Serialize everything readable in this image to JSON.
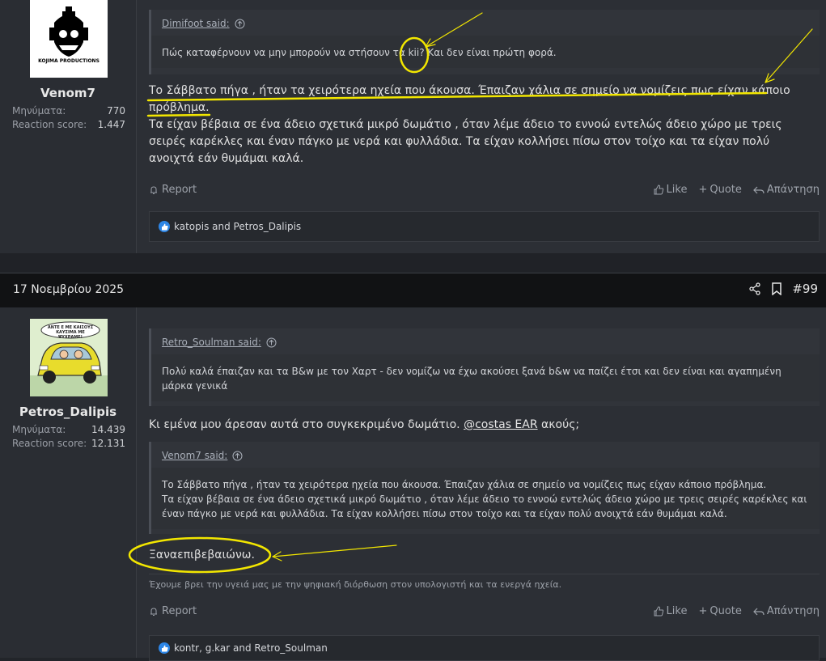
{
  "post1": {
    "username": "Venom7",
    "avatar_label": "KOJIMA PRODUCTIONS",
    "stats": [
      {
        "label": "Μηνύματα:",
        "value": "770"
      },
      {
        "label": "Reaction score:",
        "value": "1.447"
      }
    ],
    "quote": {
      "author": "Dimifoot said:",
      "body": "Πώς καταφέρνουν να μην μπορούν να στήσουν τα kii? Και δεν είναι πρώτη φορά."
    },
    "text_line1": "Το Σάββατο πήγα , ήταν τα χειρότερα ηχεία που άκουσα. Έπαιζαν χάλια σε σημείο να νομίζεις πως είχαν κάποιο",
    "text_line2": "πρόβλημα.",
    "text_para2": "Τα είχαν βέβαια σε ένα άδειο σχετικά μικρό δωμάτιο , όταν λέμε άδειο το εννοώ εντελώς άδειο χώρο με τρεις σειρές καρέκλες και έναν πάγκο με νερά και φυλλάδια. Τα είχαν κολλήσει πίσω στον τοίχο και τα είχαν πολύ ανοιχτά εάν θυμάμαι καλά.",
    "actions": {
      "report": "Report",
      "like": "Like",
      "quote": "Quote",
      "reply": "Απάντηση"
    },
    "reactions": "katopis and Petros_Dalipis"
  },
  "post2": {
    "date": "17 Νοεμβρίου 2025",
    "number": "#99",
    "username": "Petros_Dalipis",
    "avatar_caption": "ΑΝΤΕ Ε ΜΕ ΚΑΙΣΟΥΣ ΚΑΥΣΙΜΑ ΜΕ ΨΥΧΡΑΜΕ!",
    "stats": [
      {
        "label": "Μηνύματα:",
        "value": "14.439"
      },
      {
        "label": "Reaction score:",
        "value": "12.131"
      }
    ],
    "quote1": {
      "author": "Retro_Soulman said:",
      "body": "Πολύ καλά έπαιζαν και τα B&w με τον Χαρτ - δεν νομίζω να έχω ακούσει ξανά b&w να παίζει έτσι και δεν είναι και αγαπημένη μάρκα γενικά"
    },
    "text1_before": "Κι εμένα μου άρεσαν αυτά στο συγκεκριμένο δωμάτιο. ",
    "mention": "@costas EAR",
    "text1_after": " ακούς;",
    "quote2": {
      "author": "Venom7 said:",
      "line1": "Το Σάββατο πήγα , ήταν τα χειρότερα ηχεία που άκουσα. Έπαιζαν χάλια σε σημείο να νομίζεις πως είχαν κάποιο πρόβλημα.",
      "line2": "Τα είχαν βέβαια σε ένα άδειο σχετικά μικρό δωμάτιο , όταν λέμε άδειο το εννοώ εντελώς άδειο χώρο με τρεις σειρές καρέκλες και έναν πάγκο με νερά και φυλλάδια. Τα είχαν κολλήσει πίσω στον τοίχο και τα είχαν πολύ ανοιχτά εάν θυμάμαι καλά."
    },
    "text2": "Ξαναεπιβεβαιώνω.",
    "signature": "Έχουμε βρει την υγειά μας με την ψηφιακή διόρθωση στον υπολογιστή και τα ενεργά ηχεία.",
    "actions": {
      "report": "Report",
      "like": "Like",
      "quote": "Quote",
      "reply": "Απάντηση"
    },
    "reactions": "kontr, g.kar and Retro_Soulman"
  },
  "colors": {
    "annotation": "#f2e600",
    "like_badge": "#2d86e6"
  }
}
